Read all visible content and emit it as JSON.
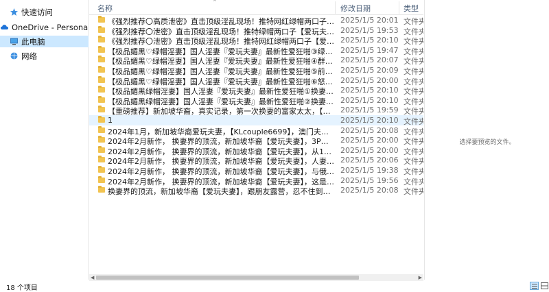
{
  "nav": {
    "items": [
      {
        "label": "快速访问",
        "icon": "star-icon",
        "selected": false
      },
      {
        "label": "OneDrive - Personal",
        "icon": "cloud-icon",
        "selected": false
      },
      {
        "label": "此电脑",
        "icon": "computer-icon",
        "selected": true
      },
      {
        "label": "网络",
        "icon": "network-icon",
        "selected": false
      }
    ]
  },
  "columns": {
    "name": "名称",
    "date": "修改日期",
    "type": "类型"
  },
  "files": [
    {
      "name": "《强烈推荐〇高质泄密》直击顶级淫乱现场！推特网红绿帽两口子【爱...",
      "date": "2025/1/5 20:01",
      "type": "文件夹"
    },
    {
      "name": "《强烈推荐〇泄密》直击顶级淫乱现场！推特绿帽两口子【爱玩夫妻】...",
      "date": "2025/1/5 19:53",
      "type": "文件夹"
    },
    {
      "name": "《强烈推荐〇泄密》直击顶级淫乱现场！推特网红绿帽两口子【爱玩夫...",
      "date": "2025/1/5 20:10",
      "type": "文件夹"
    },
    {
      "name": "【极品媚黑♡绿帽淫妻】国人淫妻『爱玩夫妻』最新性爱狂啪③绿帽老...",
      "date": "2025/1/5 19:47",
      "type": "文件夹"
    },
    {
      "name": "【极品媚黑♡绿帽淫妻】国人淫妻『爱玩夫妻』最新性爱狂啪④群交派...",
      "date": "2025/1/5 20:07",
      "type": "文件夹"
    },
    {
      "name": "【极品媚黑♡绿帽淫妻】国人淫妻『爱玩夫妻』最新性爱狂啪⑤前裹后...",
      "date": "2025/1/5 20:09",
      "type": "文件夹"
    },
    {
      "name": "【极品媚黑♡绿帽淫妻】国人淫妻『爱玩夫妻』最新性爱狂啪⑥怒插爆...",
      "date": "2025/1/5 20:00",
      "type": "文件夹"
    },
    {
      "name": "【极品媚黑绿帽淫妻】国人淫妻『爱玩夫妻』最新性爱狂啪①换妻淫交...",
      "date": "2025/1/5 20:10",
      "type": "文件夹"
    },
    {
      "name": "【极品媚黑绿帽淫妻】国人淫妻『爱玩夫妻』最新性爱狂啪②换妻群交...",
      "date": "2025/1/5 20:10",
      "type": "文件夹"
    },
    {
      "name": "【重磅推荐】新加坡华裔，真实记录，第一次换妻的富家太太，【爱玩...",
      "date": "2025/1/5 19:59",
      "type": "文件夹"
    },
    {
      "name": "1",
      "date": "2025/1/5 20:10",
      "type": "文件夹",
      "hover": true
    },
    {
      "name": "2024年1月，新加坡华裔爱玩夫妻，【KLcouple6699】，澳门夫妻交...",
      "date": "2025/1/5 20:08",
      "type": "文件夹"
    },
    {
      "name": "2024年2月新作， 换妻界的顶流，新加坡华裔【爱玩夫妻】，3P的心...",
      "date": "2025/1/5 20:00",
      "type": "文件夹"
    },
    {
      "name": "2024年2月新作， 换妻界的顶流，新加坡华裔【爱玩夫妻】，从10对夫...",
      "date": "2025/1/5 20:00",
      "type": "文件夹"
    },
    {
      "name": "2024年2月新作， 换妻界的顶流，新加坡华裔【爱玩夫妻】，人妻第一...",
      "date": "2025/1/5 20:06",
      "type": "文件夹"
    },
    {
      "name": "2024年2月新作， 换妻界的顶流，新加坡华裔【爱玩夫妻】，与俄罗斯...",
      "date": "2025/1/5 19:38",
      "type": "文件夹"
    },
    {
      "name": "2024年2月新作， 换妻界的顶流，新加坡华裔【爱玩夫妻】，这是一场...",
      "date": "2025/1/5 19:56",
      "type": "文件夹"
    },
    {
      "name": "换妻界的顶流，新加坡华裔【爱玩夫妻】，跟朋友露营，忍不住到小溪...",
      "date": "2025/1/5 20:08",
      "type": "文件夹"
    }
  ],
  "preview": {
    "message": "选择要预览的文件。"
  },
  "status": {
    "count": "18 个项目"
  }
}
